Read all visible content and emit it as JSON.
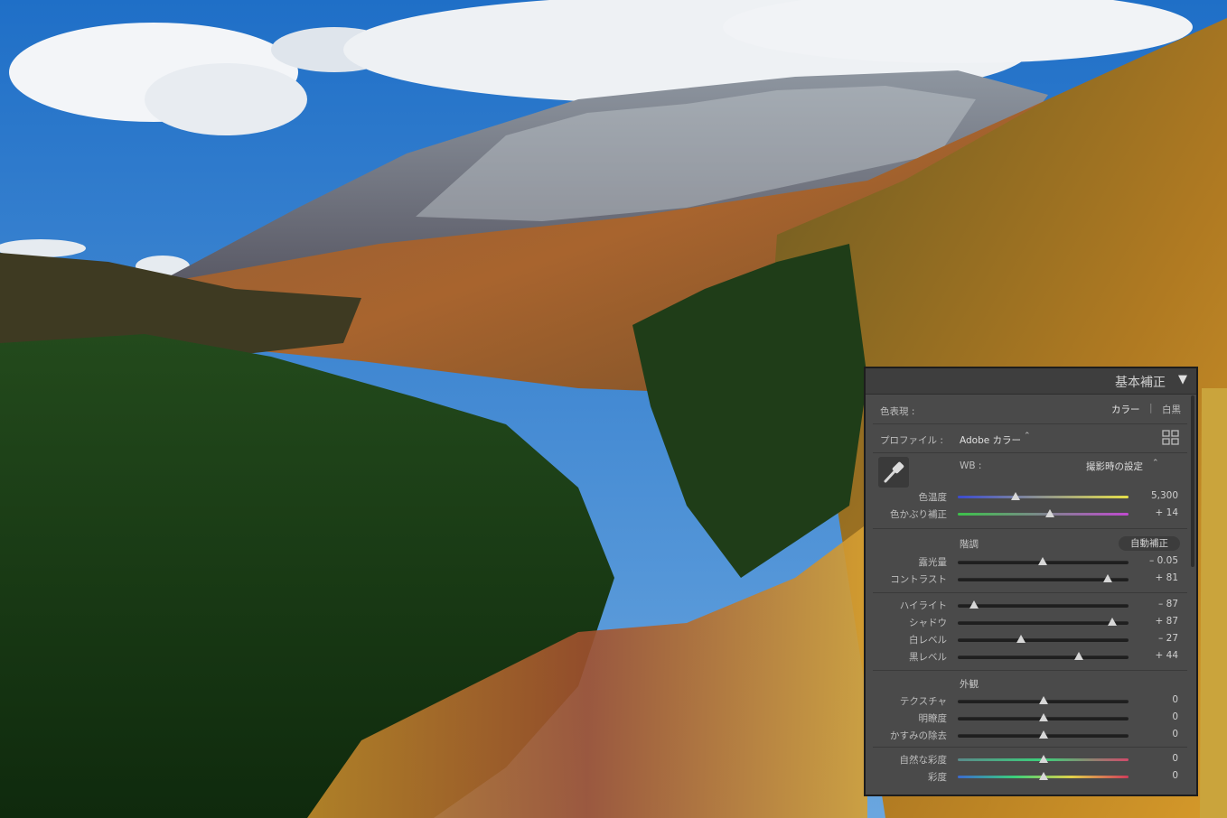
{
  "panel": {
    "title": "基本補正",
    "collapse_glyph": "▼",
    "treatment": {
      "label": "色表現 :",
      "color": "カラー",
      "bw": "白黒",
      "divider": "|"
    },
    "profile": {
      "label": "プロファイル :",
      "value": "Adobe カラー",
      "arrows": "⌃"
    },
    "wb": {
      "label": "WB :",
      "value": "撮影時の設定",
      "arrows": "⌃"
    },
    "temp": {
      "label": "色温度",
      "value": "5,300",
      "position": 0.34
    },
    "tint": {
      "label": "色かぶり補正",
      "value": "+ 14",
      "position": 0.54
    },
    "tone": {
      "title": "階調",
      "auto": "自動補正"
    },
    "exposure": {
      "label": "露光量",
      "value": "– 0.05",
      "position": 0.495
    },
    "contrast": {
      "label": "コントラスト",
      "value": "+ 81",
      "position": 0.88
    },
    "highlights": {
      "label": "ハイライト",
      "value": "– 87",
      "position": 0.095
    },
    "shadows": {
      "label": "シャドウ",
      "value": "+ 87",
      "position": 0.905
    },
    "whites": {
      "label": "白レベル",
      "value": "– 27",
      "position": 0.37
    },
    "blacks": {
      "label": "黒レベル",
      "value": "+ 44",
      "position": 0.71
    },
    "presence": {
      "title": "外観"
    },
    "texture": {
      "label": "テクスチャ",
      "value": "0",
      "position": 0.5
    },
    "clarity": {
      "label": "明瞭度",
      "value": "0",
      "position": 0.5
    },
    "dehaze": {
      "label": "かすみの除去",
      "value": "0",
      "position": 0.5
    },
    "vibrance": {
      "label": "自然な彩度",
      "value": "0",
      "position": 0.5
    },
    "saturation": {
      "label": "彩度",
      "value": "0",
      "position": 0.5
    }
  },
  "colors": {
    "panel_bg": "#4a4a4a",
    "temp_gradient": [
      "#3b4bd1",
      "#e6e04a"
    ],
    "tint_gradient": [
      "#3cc24a",
      "#c04ad0"
    ]
  }
}
